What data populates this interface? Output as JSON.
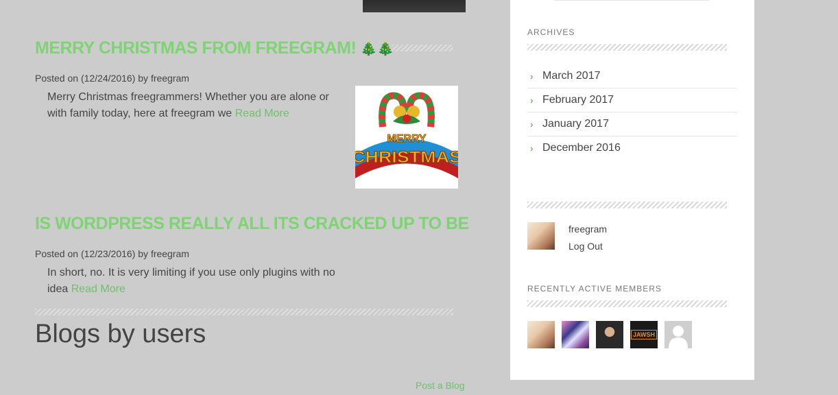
{
  "posts": [
    {
      "title": "MERRY CHRISTMAS FROM FREEGRAM!",
      "title_icons": "🎄🎄",
      "meta_prefix": "Posted on",
      "date": "(12/24/2016)",
      "meta_by": "by",
      "author": "freegram",
      "excerpt": "Merry Christmas freegrammers! Whether you are alone or with family today, here at freegram we",
      "read_more": "Read More",
      "image_text": "MERRY CHRISTMAS"
    },
    {
      "title": "IS WORDPRESS REALLY ALL ITS CRACKED UP TO BE",
      "meta_prefix": "Posted on",
      "date": "(12/23/2016)",
      "meta_by": "by",
      "author": "freegram",
      "excerpt": "In short, no. It is very limiting if you use only plugins with no idea",
      "read_more": "Read More"
    }
  ],
  "blogs_section": {
    "title": "Blogs by users",
    "post_blog_link": "Post a Blog"
  },
  "sidebar": {
    "archives": {
      "title": "ARCHIVES",
      "items": [
        "March 2017",
        "February 2017",
        "January 2017",
        "December 2016"
      ]
    },
    "user": {
      "name": "freegram",
      "logout": "Log Out"
    },
    "members": {
      "title": "RECENTLY ACTIVE MEMBERS",
      "badge_text": "JAWSH"
    }
  },
  "colors": {
    "accent": "#7ed472",
    "link": "#6fc06a",
    "background": "#cccccc",
    "sidebar": "#ffffff"
  }
}
